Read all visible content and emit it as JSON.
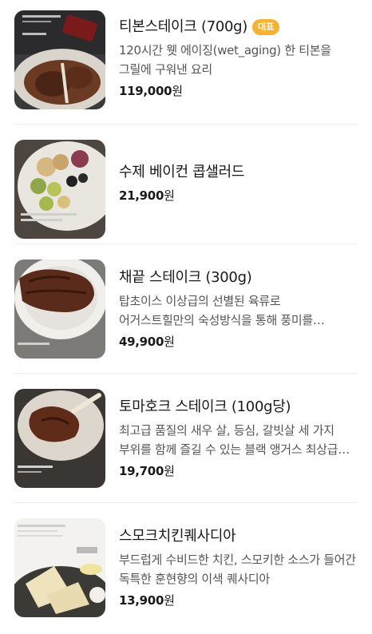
{
  "menu_items": [
    {
      "name": "티본스테이크 (700g)",
      "badge": "대표",
      "description": "120시간 웻 에이징(wet_aging) 한 티본을 그릴에 구워낸 요리",
      "price": "119,000",
      "currency": "원"
    },
    {
      "name": "수제 베이컨 콥샐러드",
      "description": "",
      "price": "21,900",
      "currency": "원"
    },
    {
      "name": "채끝 스테이크 (300g)",
      "description": "탑초이스 이상급의 선별된 육류로 어거스트힐만의 숙성방식을 통해 풍미를 극대화한 채끝 스테이크",
      "price": "49,900",
      "currency": "원"
    },
    {
      "name": "토마호크 스테이크 (100g당)",
      "description": "최고급 품질의 새우 살, 등심, 갈빗살 세 가지 부위를 함께 즐길 수 있는 블랙 앵거스 최상급 토마호크",
      "price": "19,700",
      "currency": "원"
    },
    {
      "name": "스모크치킨퀘사디아",
      "description": "부드럽게 수비드한 치킨, 스모키한 소스가 들어간 독특한 훈현향의 이색 퀘사디아",
      "price": "13,900",
      "currency": "원"
    }
  ],
  "colors": {
    "badge_background": "#f6b233",
    "price_text": "#1a1a1a",
    "description_text": "#555555",
    "divider": "#eeeeee"
  }
}
